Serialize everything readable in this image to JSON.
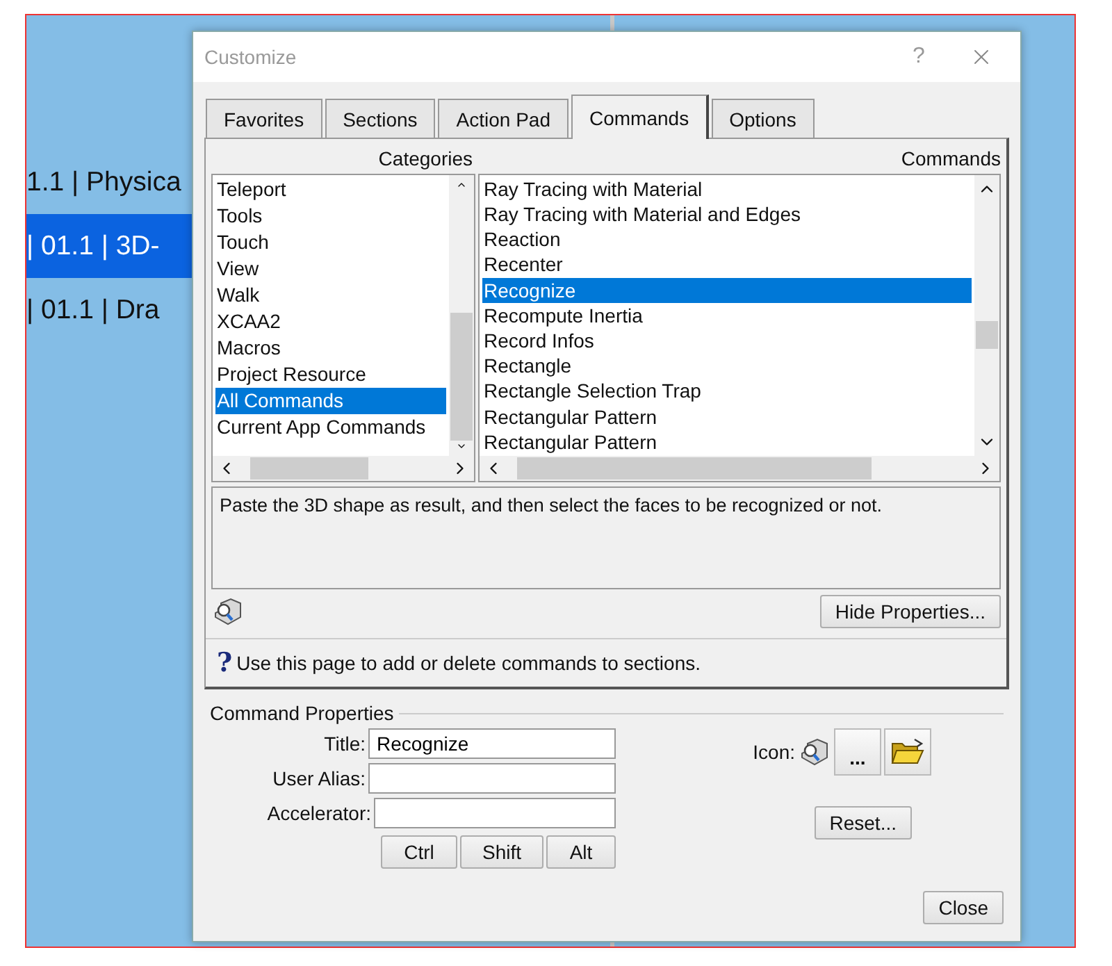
{
  "background": {
    "rows": [
      {
        "label": "1.1 | Physica",
        "selected": false
      },
      {
        "label": "| 01.1 | 3D-",
        "selected": true
      },
      {
        "label": "| 01.1 | Dra",
        "selected": false
      }
    ]
  },
  "dialog": {
    "title": "Customize",
    "help": "?",
    "tabs": [
      {
        "label": "Favorites",
        "selected": false
      },
      {
        "label": "Sections",
        "selected": false
      },
      {
        "label": "Action Pad",
        "selected": false
      },
      {
        "label": "Commands",
        "selected": true
      },
      {
        "label": "Options",
        "selected": false
      }
    ],
    "categories": {
      "header": "Categories",
      "items": [
        {
          "label": "Teleport",
          "selected": false
        },
        {
          "label": "Tools",
          "selected": false
        },
        {
          "label": "Touch",
          "selected": false
        },
        {
          "label": "View",
          "selected": false
        },
        {
          "label": "Walk",
          "selected": false
        },
        {
          "label": "XCAA2",
          "selected": false
        },
        {
          "label": "Macros",
          "selected": false
        },
        {
          "label": "Project Resource",
          "selected": false
        },
        {
          "label": "All Commands",
          "selected": true
        },
        {
          "label": "Current App Commands",
          "selected": false
        }
      ]
    },
    "commands": {
      "header": "Commands",
      "items": [
        {
          "label": "Ray Tracing with Material",
          "selected": false
        },
        {
          "label": "Ray Tracing with Material and Edges",
          "selected": false
        },
        {
          "label": "Reaction",
          "selected": false
        },
        {
          "label": "Recenter",
          "selected": false
        },
        {
          "label": "Recognize",
          "selected": true
        },
        {
          "label": "Recompute Inertia",
          "selected": false
        },
        {
          "label": "Record Infos",
          "selected": false
        },
        {
          "label": "Rectangle",
          "selected": false
        },
        {
          "label": "Rectangle Selection Trap",
          "selected": false
        },
        {
          "label": "Rectangular Pattern",
          "selected": false
        },
        {
          "label": "Rectangular Pattern",
          "selected": false
        }
      ]
    },
    "description": "Paste the 3D shape as result, and then select the faces to be recognized or not.",
    "hide_properties_button": "Hide Properties...",
    "hint": {
      "mark": "?",
      "text": "Use this page to add or delete commands to sections."
    },
    "command_properties": {
      "legend": "Command Properties",
      "fields": [
        {
          "label": "Title:",
          "value": "Recognize"
        },
        {
          "label": "User Alias:"
        },
        {
          "label": "Accelerator:"
        }
      ],
      "modifier_buttons": [
        "Ctrl",
        "Shift",
        "Alt"
      ],
      "icon_label": "Icon:",
      "browse_button": "...",
      "reset_button": "Reset..."
    },
    "close_button": "Close"
  }
}
